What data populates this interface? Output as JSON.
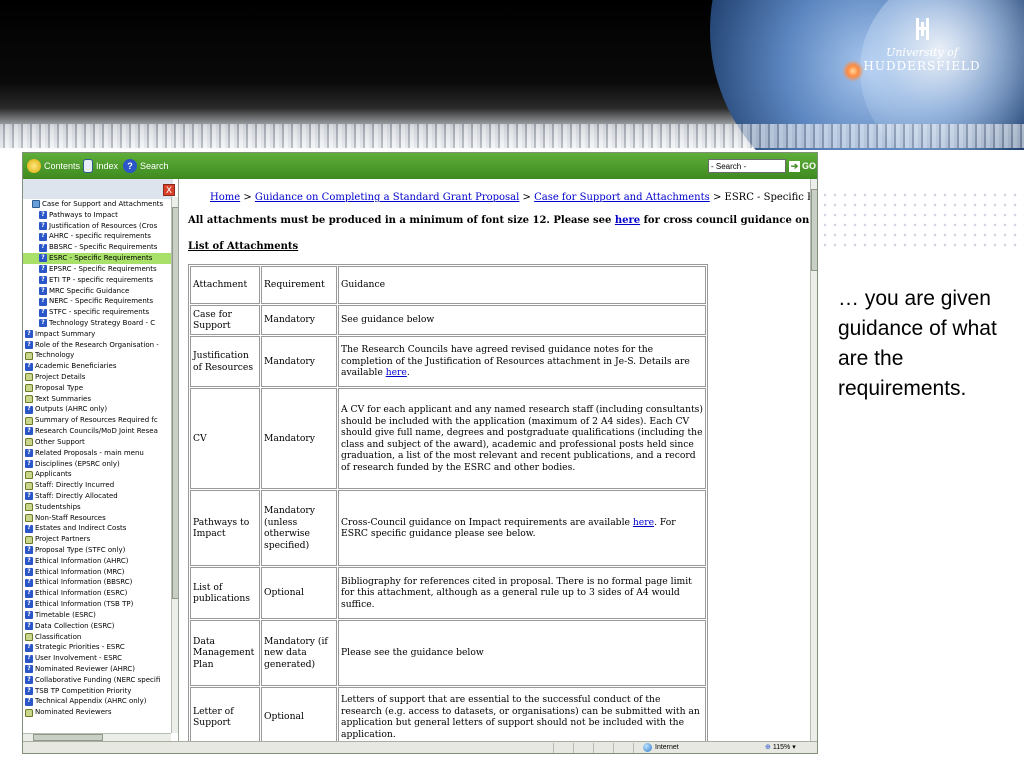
{
  "slide": {
    "logo": {
      "line1": "University of",
      "line2": "HUDDERSFIELD"
    },
    "caption": "… you are given guidance of what are the requirements."
  },
  "toolbar": {
    "contents_label": "Contents",
    "index_label": "Index",
    "search_label": "Search",
    "search_value": "- Search -",
    "go_label": "GO"
  },
  "tree": {
    "close_label": "X",
    "items": [
      {
        "label": "Case for Support and Attachments",
        "icon": "book-icon",
        "indent": 1
      },
      {
        "label": "Pathways to Impact",
        "icon": "help-icon",
        "indent": 2
      },
      {
        "label": "Justification of Resources (Cros",
        "icon": "help-icon",
        "indent": 2
      },
      {
        "label": "AHRC - specific requirements",
        "icon": "help-icon",
        "indent": 2
      },
      {
        "label": "BBSRC - Specific Requirements",
        "icon": "help-icon",
        "indent": 2
      },
      {
        "label": "ESRC - Specific Requirements",
        "icon": "help-icon",
        "indent": 2,
        "selected": true
      },
      {
        "label": "EPSRC - Specific Requirements",
        "icon": "help-icon",
        "indent": 2
      },
      {
        "label": "ETI TP - specific requirements",
        "icon": "help-icon",
        "indent": 2
      },
      {
        "label": "MRC Specific Guidance",
        "icon": "help-icon",
        "indent": 2
      },
      {
        "label": "NERC - Specific Requirements",
        "icon": "help-icon",
        "indent": 2
      },
      {
        "label": "STFC - specific requirements",
        "icon": "help-icon",
        "indent": 2
      },
      {
        "label": "Technology Strategy Board - C",
        "icon": "help-icon",
        "indent": 2
      },
      {
        "label": "Impact Summary",
        "icon": "help-icon",
        "indent": 0
      },
      {
        "label": "Role of the Research Organisation -",
        "icon": "help-icon",
        "indent": 0
      },
      {
        "label": "Technology",
        "icon": "folder-icon",
        "indent": 0
      },
      {
        "label": "Academic Beneficiaries",
        "icon": "help-icon",
        "indent": 0
      },
      {
        "label": "Project Details",
        "icon": "folder-icon",
        "indent": 0
      },
      {
        "label": "Proposal Type",
        "icon": "folder-icon",
        "indent": 0
      },
      {
        "label": "Text Summaries",
        "icon": "folder-icon",
        "indent": 0
      },
      {
        "label": "Outputs (AHRC only)",
        "icon": "help-icon",
        "indent": 0
      },
      {
        "label": "Summary of Resources Required fc",
        "icon": "folder-icon",
        "indent": 0
      },
      {
        "label": "Research Councils/MoD Joint Resea",
        "icon": "help-icon",
        "indent": 0
      },
      {
        "label": "Other Support",
        "icon": "folder-icon",
        "indent": 0
      },
      {
        "label": "Related Proposals - main menu",
        "icon": "help-icon",
        "indent": 0
      },
      {
        "label": "Disciplines (EPSRC only)",
        "icon": "help-icon",
        "indent": 0
      },
      {
        "label": "Applicants",
        "icon": "folder-icon",
        "indent": 0
      },
      {
        "label": "Staff: Directly Incurred",
        "icon": "folder-icon",
        "indent": 0
      },
      {
        "label": "Staff: Directly Allocated",
        "icon": "help-icon",
        "indent": 0
      },
      {
        "label": "Studentships",
        "icon": "folder-icon",
        "indent": 0
      },
      {
        "label": "Non-Staff Resources",
        "icon": "folder-icon",
        "indent": 0
      },
      {
        "label": "Estates and Indirect Costs",
        "icon": "help-icon",
        "indent": 0
      },
      {
        "label": "Project Partners",
        "icon": "folder-icon",
        "indent": 0
      },
      {
        "label": "Proposal Type (STFC only)",
        "icon": "help-icon",
        "indent": 0
      },
      {
        "label": "Ethical Information (AHRC)",
        "icon": "help-icon",
        "indent": 0
      },
      {
        "label": "Ethical Information (MRC)",
        "icon": "help-icon",
        "indent": 0
      },
      {
        "label": "Ethical Information (BBSRC)",
        "icon": "help-icon",
        "indent": 0
      },
      {
        "label": "Ethical Information (ESRC)",
        "icon": "help-icon",
        "indent": 0
      },
      {
        "label": "Ethical Information (TSB TP)",
        "icon": "help-icon",
        "indent": 0
      },
      {
        "label": "Timetable (ESRC)",
        "icon": "help-icon",
        "indent": 0
      },
      {
        "label": "Data Collection (ESRC)",
        "icon": "help-icon",
        "indent": 0
      },
      {
        "label": "Classification",
        "icon": "folder-icon",
        "indent": 0
      },
      {
        "label": "Strategic Priorities - ESRC",
        "icon": "help-icon",
        "indent": 0
      },
      {
        "label": "User Involvement - ESRC",
        "icon": "help-icon",
        "indent": 0
      },
      {
        "label": "Nominated Reviewer (AHRC)",
        "icon": "help-icon",
        "indent": 0
      },
      {
        "label": "Collaborative Funding (NERC specifi",
        "icon": "help-icon",
        "indent": 0
      },
      {
        "label": "TSB TP Competition Priority",
        "icon": "help-icon",
        "indent": 0
      },
      {
        "label": "Technical Appendix (AHRC only)",
        "icon": "help-icon",
        "indent": 0
      },
      {
        "label": "Nominated Reviewers",
        "icon": "folder-icon",
        "indent": 0
      }
    ]
  },
  "content": {
    "breadcrumb": {
      "home": "Home",
      "sep": " > ",
      "level1": "Guidance on Completing a Standard Grant Proposal",
      "level2": "Case for Support and Attachments",
      "current": "ESRC - Specific Requirements"
    },
    "notice": {
      "before": "All attachments must be produced in a minimum of font size 12. Please see ",
      "link": "here",
      "after": " for cross council guidance on attachments."
    },
    "list_heading": "List of Attachments",
    "table": {
      "headers": [
        "Attachment",
        "Requirement",
        "Guidance"
      ],
      "rows": [
        {
          "attachment": "Case for Support",
          "requirement": "Mandatory",
          "guidance": "See guidance below",
          "link": "",
          "after": ""
        },
        {
          "attachment": "Justification of Resources",
          "requirement": "Mandatory",
          "guidance": "The Research Councils have agreed revised guidance notes for the completion of the Justification of Resources attachment in Je-S. Details are available ",
          "link": "here",
          "after": "."
        },
        {
          "attachment": "CV",
          "requirement": "Mandatory",
          "guidance": "A CV for each applicant and any named research staff (including consultants) should be included with the application (maximum of 2 A4 sides). Each CV should give full name, degrees and postgraduate qualifications (including the class and subject of the award), academic and professional posts held since graduation, a list of the most relevant and recent publications, and a record of research funded by the ESRC and other bodies.",
          "link": "",
          "after": ""
        },
        {
          "attachment": "Pathways to Impact",
          "requirement": "Mandatory (unless otherwise specified)",
          "guidance": "Cross-Council guidance on Impact requirements are available ",
          "link": "here",
          "after": ". For ESRC specific guidance please see below."
        },
        {
          "attachment": "List of publications",
          "requirement": "Optional",
          "guidance": "Bibliography for references cited in proposal. There is no formal page limit for this attachment, although as a general rule up to 3 sides of A4 would suffice.",
          "link": "",
          "after": ""
        },
        {
          "attachment": "Data Management Plan",
          "requirement": "Mandatory (if new data generated)",
          "guidance": "Please see the guidance below",
          "link": "",
          "after": ""
        },
        {
          "attachment": "Letter of Support",
          "requirement": "Optional",
          "guidance": "Letters of support that are essential to the successful conduct of the research (e.g. access to datasets, or organisations) can be submitted with an application but general letters of support should not be included with the application.",
          "link": "",
          "after": ""
        }
      ]
    }
  },
  "statusbar": {
    "zone": "Internet",
    "zoom": "115%"
  }
}
